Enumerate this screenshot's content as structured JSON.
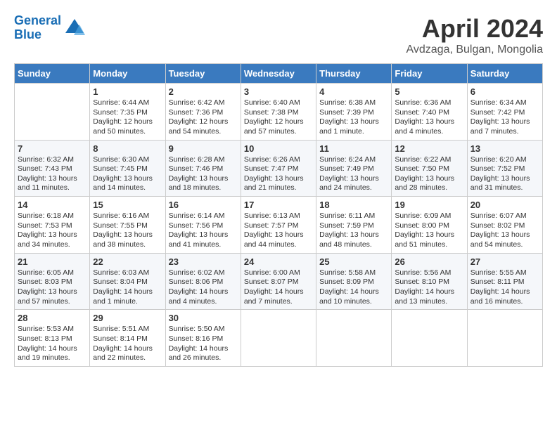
{
  "header": {
    "logo_line1": "General",
    "logo_line2": "Blue",
    "month_title": "April 2024",
    "location": "Avdzaga, Bulgan, Mongolia"
  },
  "weekdays": [
    "Sunday",
    "Monday",
    "Tuesday",
    "Wednesday",
    "Thursday",
    "Friday",
    "Saturday"
  ],
  "weeks": [
    [
      {
        "day": "",
        "data": ""
      },
      {
        "day": "1",
        "data": "Sunrise: 6:44 AM\nSunset: 7:35 PM\nDaylight: 12 hours\nand 50 minutes."
      },
      {
        "day": "2",
        "data": "Sunrise: 6:42 AM\nSunset: 7:36 PM\nDaylight: 12 hours\nand 54 minutes."
      },
      {
        "day": "3",
        "data": "Sunrise: 6:40 AM\nSunset: 7:38 PM\nDaylight: 12 hours\nand 57 minutes."
      },
      {
        "day": "4",
        "data": "Sunrise: 6:38 AM\nSunset: 7:39 PM\nDaylight: 13 hours\nand 1 minute."
      },
      {
        "day": "5",
        "data": "Sunrise: 6:36 AM\nSunset: 7:40 PM\nDaylight: 13 hours\nand 4 minutes."
      },
      {
        "day": "6",
        "data": "Sunrise: 6:34 AM\nSunset: 7:42 PM\nDaylight: 13 hours\nand 7 minutes."
      }
    ],
    [
      {
        "day": "7",
        "data": "Sunrise: 6:32 AM\nSunset: 7:43 PM\nDaylight: 13 hours\nand 11 minutes."
      },
      {
        "day": "8",
        "data": "Sunrise: 6:30 AM\nSunset: 7:45 PM\nDaylight: 13 hours\nand 14 minutes."
      },
      {
        "day": "9",
        "data": "Sunrise: 6:28 AM\nSunset: 7:46 PM\nDaylight: 13 hours\nand 18 minutes."
      },
      {
        "day": "10",
        "data": "Sunrise: 6:26 AM\nSunset: 7:47 PM\nDaylight: 13 hours\nand 21 minutes."
      },
      {
        "day": "11",
        "data": "Sunrise: 6:24 AM\nSunset: 7:49 PM\nDaylight: 13 hours\nand 24 minutes."
      },
      {
        "day": "12",
        "data": "Sunrise: 6:22 AM\nSunset: 7:50 PM\nDaylight: 13 hours\nand 28 minutes."
      },
      {
        "day": "13",
        "data": "Sunrise: 6:20 AM\nSunset: 7:52 PM\nDaylight: 13 hours\nand 31 minutes."
      }
    ],
    [
      {
        "day": "14",
        "data": "Sunrise: 6:18 AM\nSunset: 7:53 PM\nDaylight: 13 hours\nand 34 minutes."
      },
      {
        "day": "15",
        "data": "Sunrise: 6:16 AM\nSunset: 7:55 PM\nDaylight: 13 hours\nand 38 minutes."
      },
      {
        "day": "16",
        "data": "Sunrise: 6:14 AM\nSunset: 7:56 PM\nDaylight: 13 hours\nand 41 minutes."
      },
      {
        "day": "17",
        "data": "Sunrise: 6:13 AM\nSunset: 7:57 PM\nDaylight: 13 hours\nand 44 minutes."
      },
      {
        "day": "18",
        "data": "Sunrise: 6:11 AM\nSunset: 7:59 PM\nDaylight: 13 hours\nand 48 minutes."
      },
      {
        "day": "19",
        "data": "Sunrise: 6:09 AM\nSunset: 8:00 PM\nDaylight: 13 hours\nand 51 minutes."
      },
      {
        "day": "20",
        "data": "Sunrise: 6:07 AM\nSunset: 8:02 PM\nDaylight: 13 hours\nand 54 minutes."
      }
    ],
    [
      {
        "day": "21",
        "data": "Sunrise: 6:05 AM\nSunset: 8:03 PM\nDaylight: 13 hours\nand 57 minutes."
      },
      {
        "day": "22",
        "data": "Sunrise: 6:03 AM\nSunset: 8:04 PM\nDaylight: 14 hours\nand 1 minute."
      },
      {
        "day": "23",
        "data": "Sunrise: 6:02 AM\nSunset: 8:06 PM\nDaylight: 14 hours\nand 4 minutes."
      },
      {
        "day": "24",
        "data": "Sunrise: 6:00 AM\nSunset: 8:07 PM\nDaylight: 14 hours\nand 7 minutes."
      },
      {
        "day": "25",
        "data": "Sunrise: 5:58 AM\nSunset: 8:09 PM\nDaylight: 14 hours\nand 10 minutes."
      },
      {
        "day": "26",
        "data": "Sunrise: 5:56 AM\nSunset: 8:10 PM\nDaylight: 14 hours\nand 13 minutes."
      },
      {
        "day": "27",
        "data": "Sunrise: 5:55 AM\nSunset: 8:11 PM\nDaylight: 14 hours\nand 16 minutes."
      }
    ],
    [
      {
        "day": "28",
        "data": "Sunrise: 5:53 AM\nSunset: 8:13 PM\nDaylight: 14 hours\nand 19 minutes."
      },
      {
        "day": "29",
        "data": "Sunrise: 5:51 AM\nSunset: 8:14 PM\nDaylight: 14 hours\nand 22 minutes."
      },
      {
        "day": "30",
        "data": "Sunrise: 5:50 AM\nSunset: 8:16 PM\nDaylight: 14 hours\nand 26 minutes."
      },
      {
        "day": "",
        "data": ""
      },
      {
        "day": "",
        "data": ""
      },
      {
        "day": "",
        "data": ""
      },
      {
        "day": "",
        "data": ""
      }
    ]
  ]
}
